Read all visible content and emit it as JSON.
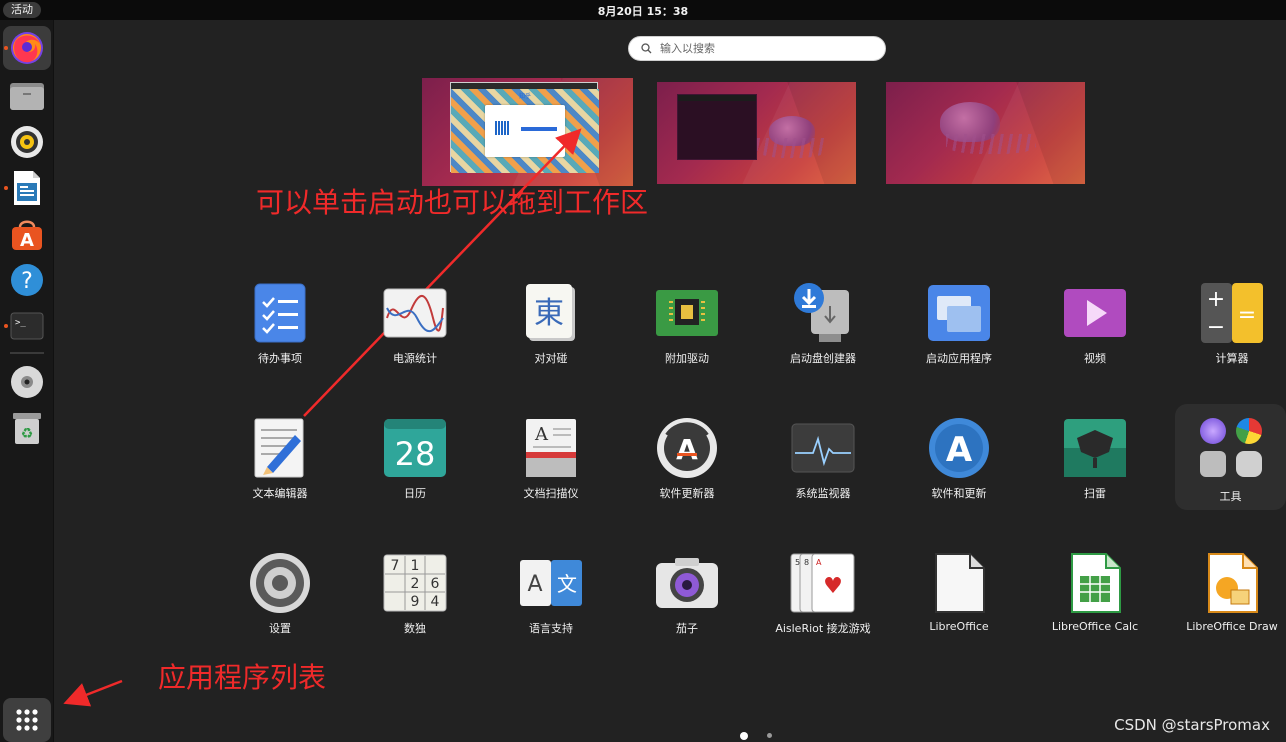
{
  "topbar": {
    "activities_label": "活动",
    "clock": "8月20日  15：38"
  },
  "dock": {
    "items": [
      {
        "name": "firefox",
        "running": true,
        "active": true
      },
      {
        "name": "files",
        "running": false
      },
      {
        "name": "rhythmbox",
        "running": false
      },
      {
        "name": "libreoffice-writer",
        "running": true
      },
      {
        "name": "ubuntu-software",
        "running": false
      },
      {
        "name": "help",
        "running": false
      },
      {
        "name": "terminal",
        "running": true
      },
      {
        "name": "disc",
        "running": false
      },
      {
        "name": "trash",
        "running": false
      }
    ],
    "show_apps_icon": "grid-icon"
  },
  "search": {
    "placeholder": "输入以搜索",
    "value": ""
  },
  "workspaces": [
    {
      "name": "workspace-1",
      "window": "browser"
    },
    {
      "name": "workspace-2",
      "window": "terminal"
    },
    {
      "name": "workspace-3",
      "window": "none"
    }
  ],
  "browser_thumbnail": {
    "site_logo": "知乎"
  },
  "annotations": {
    "workspace_hint": "可以单击启动也可以拖到工作区",
    "app_list_hint": "应用程序列表",
    "color": "#f02a2a"
  },
  "apps": {
    "row1": [
      {
        "label": "待办事项",
        "icon": "todo-icon"
      },
      {
        "label": "电源统计",
        "icon": "power-stats-icon"
      },
      {
        "label": "对对碰",
        "icon": "mahjongg-icon"
      },
      {
        "label": "附加驱动",
        "icon": "chip-icon"
      },
      {
        "label": "启动盘创建器",
        "icon": "usb-creator-icon"
      },
      {
        "label": "启动应用程序",
        "icon": "startup-apps-icon"
      },
      {
        "label": "视频",
        "icon": "video-icon"
      },
      {
        "label": "计算器",
        "icon": "calculator-icon"
      }
    ],
    "row2": [
      {
        "label": "文本编辑器",
        "icon": "text-editor-icon"
      },
      {
        "label": "日历",
        "icon": "calendar-icon",
        "day": "28"
      },
      {
        "label": "文档扫描仪",
        "icon": "scanner-icon"
      },
      {
        "label": "软件更新器",
        "icon": "software-updater-icon"
      },
      {
        "label": "系统监视器",
        "icon": "system-monitor-icon"
      },
      {
        "label": "软件和更新",
        "icon": "software-properties-icon"
      },
      {
        "label": "扫雷",
        "icon": "mines-icon"
      }
    ],
    "row3": [
      {
        "label": "设置",
        "icon": "settings-icon"
      },
      {
        "label": "数独",
        "icon": "sudoku-icon"
      },
      {
        "label": "语言支持",
        "icon": "language-icon"
      },
      {
        "label": "茄子",
        "icon": "cheese-icon"
      },
      {
        "label": "AisleRiot 接龙游戏",
        "icon": "cards-icon"
      },
      {
        "label": "LibreOffice",
        "icon": "libreoffice-icon"
      },
      {
        "label": "LibreOffice Calc",
        "icon": "calc-icon"
      },
      {
        "label": "LibreOffice Draw",
        "icon": "draw-icon"
      }
    ],
    "folder": {
      "label": "工具"
    }
  },
  "sudoku_digits": [
    "7",
    "1",
    "2",
    "6",
    "9",
    "4"
  ],
  "pager": {
    "current": 1,
    "total": 2
  },
  "watermark": "CSDN @starsPromax"
}
